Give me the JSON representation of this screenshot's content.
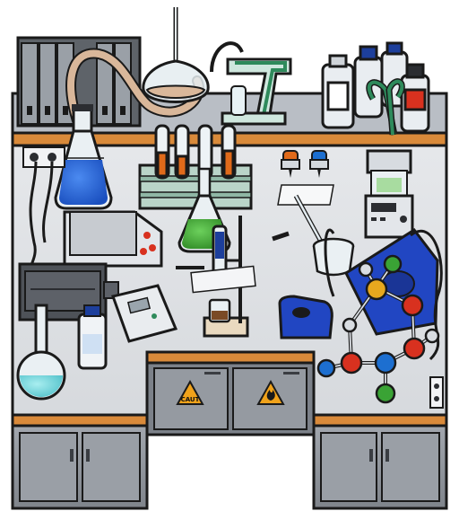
{
  "scene": {
    "type": "isometric-lab-workbench",
    "background": "#ffffff",
    "colors": {
      "outline": "#1a1a1a",
      "bench_top": "#e3e5e8",
      "bench_wood_edge": "#d98a3a",
      "cabinet": "#8c9198",
      "cabinet_dark": "#6f747b",
      "blue_liquid": "#1f5fd6",
      "green_liquid": "#3a9c2e",
      "cyan_liquid": "#6fd3d8",
      "orange_liquid": "#e06a1a",
      "hazard": "#f0a21a",
      "atom_red": "#d8311f",
      "atom_blue": "#1d6fd0",
      "atom_green": "#3aa335",
      "atom_yellow": "#e7a81e",
      "atom_grey": "#d9dde2",
      "device_blue": "#2146c2"
    },
    "hazard_labels": {
      "left": "CAUT",
      "right": ""
    },
    "objects": [
      "binder-shelf",
      "erlenmeyer-flask-blue",
      "separatory-funnel",
      "reflux-condenser",
      "test-tube-rack",
      "erlenmeyer-flask-green",
      "ring-stand-burette",
      "hot-plate-stirrer",
      "volumetric-flask-cyan",
      "reagent-bottles",
      "titrator-device",
      "molecule-model",
      "under-bench-cabinets",
      "hazard-signs",
      "digital-meter",
      "drying-oven"
    ]
  }
}
